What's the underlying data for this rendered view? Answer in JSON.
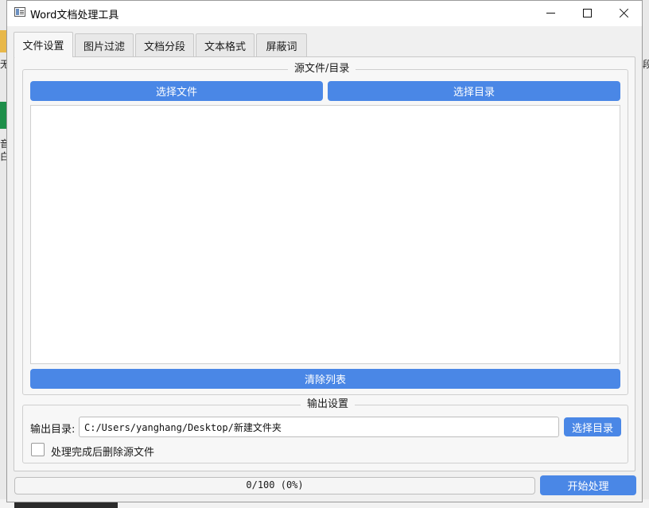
{
  "window": {
    "title": "Word文档处理工具"
  },
  "tabs": [
    {
      "label": "文件设置",
      "active": true
    },
    {
      "label": "图片过滤",
      "active": false
    },
    {
      "label": "文档分段",
      "active": false
    },
    {
      "label": "文本格式",
      "active": false
    },
    {
      "label": "屏蔽词",
      "active": false
    }
  ],
  "source_group": {
    "title": "源文件/目录",
    "select_file_label": "选择文件",
    "select_dir_label": "选择目录",
    "file_list": [],
    "clear_list_label": "清除列表"
  },
  "output_group": {
    "title": "输出设置",
    "output_dir_label": "输出目录:",
    "output_dir_value": "C:/Users/yanghang/Desktop/新建文件夹",
    "select_dir_label": "选择目录",
    "delete_source_label": "处理完成后删除源文件",
    "delete_source_checked": false
  },
  "progress": {
    "value": 0,
    "max": 100,
    "text": "0/100 (0%)"
  },
  "start_button_label": "开始处理",
  "desktop": {
    "left_char_1": "无",
    "left_char_2": "音",
    "left_char_3": "白",
    "right_char": "段"
  },
  "colors": {
    "accent": "#4a87e6",
    "window_bg": "#f0f0f0"
  }
}
